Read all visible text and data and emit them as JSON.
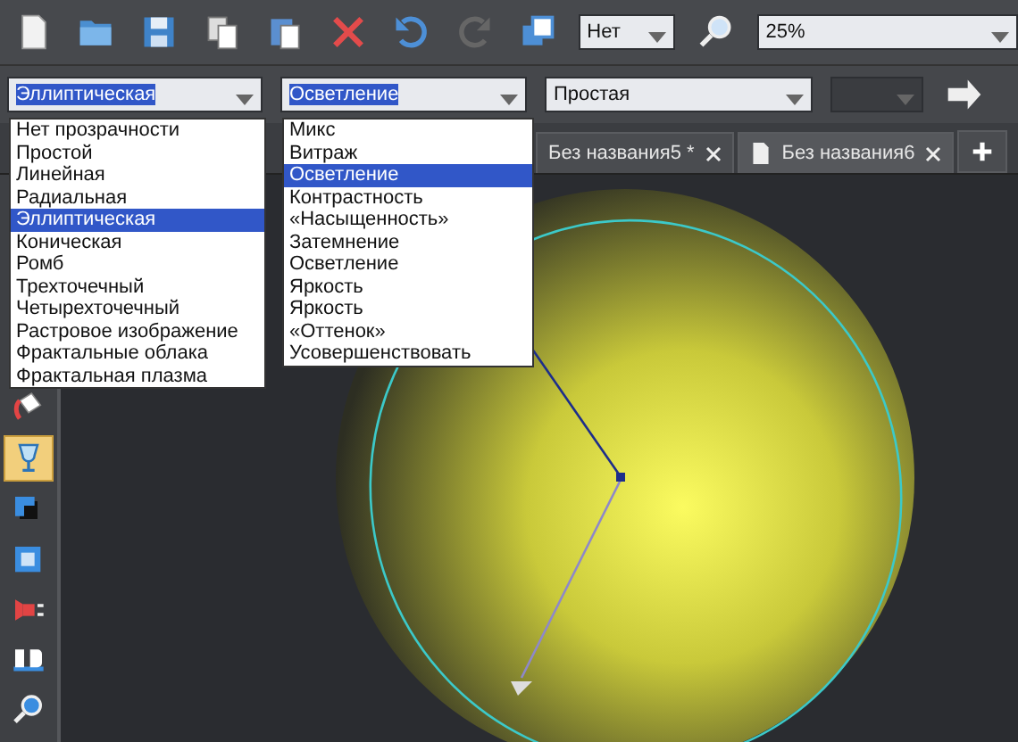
{
  "toolbar": {
    "view_combo": "Нет",
    "zoom_combo": "25%"
  },
  "transparency_bar": {
    "type_combo": "Эллиптическая",
    "mode_combo": "Осветление",
    "shape_combo": "Простая"
  },
  "type_list": [
    {
      "label": "Нет прозрачности",
      "selected": false
    },
    {
      "label": "Простой",
      "selected": false
    },
    {
      "label": "Линейная",
      "selected": false
    },
    {
      "label": "Радиальная",
      "selected": false
    },
    {
      "label": "Эллиптическая",
      "selected": true
    },
    {
      "label": "Коническая",
      "selected": false
    },
    {
      "label": "Ромб",
      "selected": false
    },
    {
      "label": "Трехточечный",
      "selected": false
    },
    {
      "label": "Четырехточечный",
      "selected": false
    },
    {
      "label": "Растровое изображение",
      "selected": false
    },
    {
      "label": "Фрактальные облака",
      "selected": false
    },
    {
      "label": "Фрактальная плазма",
      "selected": false
    }
  ],
  "mode_list": [
    {
      "label": "Микс",
      "selected": false
    },
    {
      "label": "Витраж",
      "selected": false
    },
    {
      "label": "Осветление",
      "selected": true
    },
    {
      "label": "Контрастность",
      "selected": false
    },
    {
      "label": "«Насыщенность»",
      "selected": false
    },
    {
      "label": "Затемнение",
      "selected": false
    },
    {
      "label": "Осветление",
      "selected": false
    },
    {
      "label": "Яркость",
      "selected": false
    },
    {
      "label": "Яркость",
      "selected": false
    },
    {
      "label": "«Оттенок»",
      "selected": false
    },
    {
      "label": "Усовершенствовать",
      "selected": false
    }
  ],
  "tabs": [
    {
      "label": "Без названия5 *",
      "selected": false
    },
    {
      "label": "Без названия6",
      "selected": true
    }
  ],
  "tools": [
    {
      "kind": "fill",
      "selected": false
    },
    {
      "kind": "transparency",
      "selected": true
    },
    {
      "kind": "shadow",
      "selected": false
    },
    {
      "kind": "bevel",
      "selected": false
    },
    {
      "kind": "mould",
      "selected": false
    },
    {
      "kind": "extrude",
      "selected": false
    },
    {
      "kind": "zoom",
      "selected": false
    }
  ]
}
